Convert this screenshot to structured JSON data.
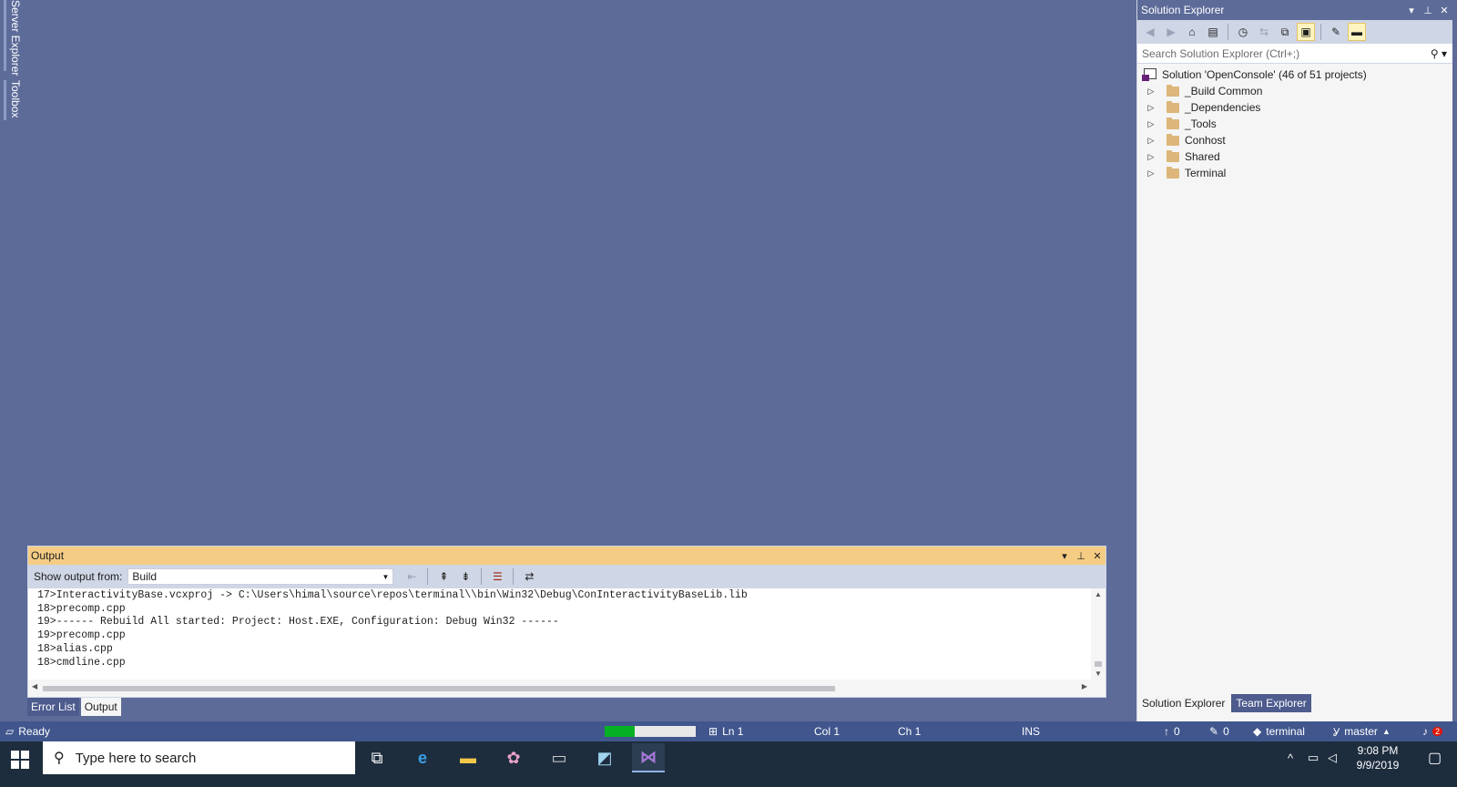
{
  "side_rail": {
    "server_explorer": "Server Explorer",
    "toolbox": "Toolbox"
  },
  "solution_explorer": {
    "title": "Solution Explorer",
    "search_placeholder": "Search Solution Explorer (Ctrl+;)",
    "solution_label": "Solution 'OpenConsole' (46 of 51 projects)",
    "folders": [
      "_Build Common",
      "_Dependencies",
      "_Tools",
      "Conhost",
      "Shared",
      "Terminal"
    ],
    "tabs": [
      "Solution Explorer",
      "Team Explorer"
    ]
  },
  "output": {
    "title": "Output",
    "show_from_label": "Show output from:",
    "source": "Build",
    "lines": [
      "17>InteractivityBase.vcxproj -> C:\\Users\\himal\\source\\repos\\terminal\\\\bin\\Win32\\Debug\\ConInteractivityBaseLib.lib",
      "18>precomp.cpp",
      "19>------ Rebuild All started: Project: Host.EXE, Configuration: Debug Win32 ------",
      "19>precomp.cpp",
      "18>alias.cpp",
      "18>cmdline.cpp"
    ],
    "tabs": [
      "Error List",
      "Output"
    ]
  },
  "status": {
    "state": "Ready",
    "progress": 0.33,
    "ln": "Ln 1",
    "col": "Col 1",
    "ch": "Ch 1",
    "mode": "INS",
    "pending_up": "0",
    "pending_edits": "0",
    "repo": "terminal",
    "branch": "master",
    "notifications": "2"
  },
  "taskbar": {
    "search_placeholder": "Type here to search",
    "time": "9:08 PM",
    "date": "9/9/2019"
  },
  "colors": {
    "editor_bg": "#5d6b99",
    "status_bar": "#40568d",
    "output_title": "#f5cc84",
    "taskbar": "#1d2d3e"
  }
}
